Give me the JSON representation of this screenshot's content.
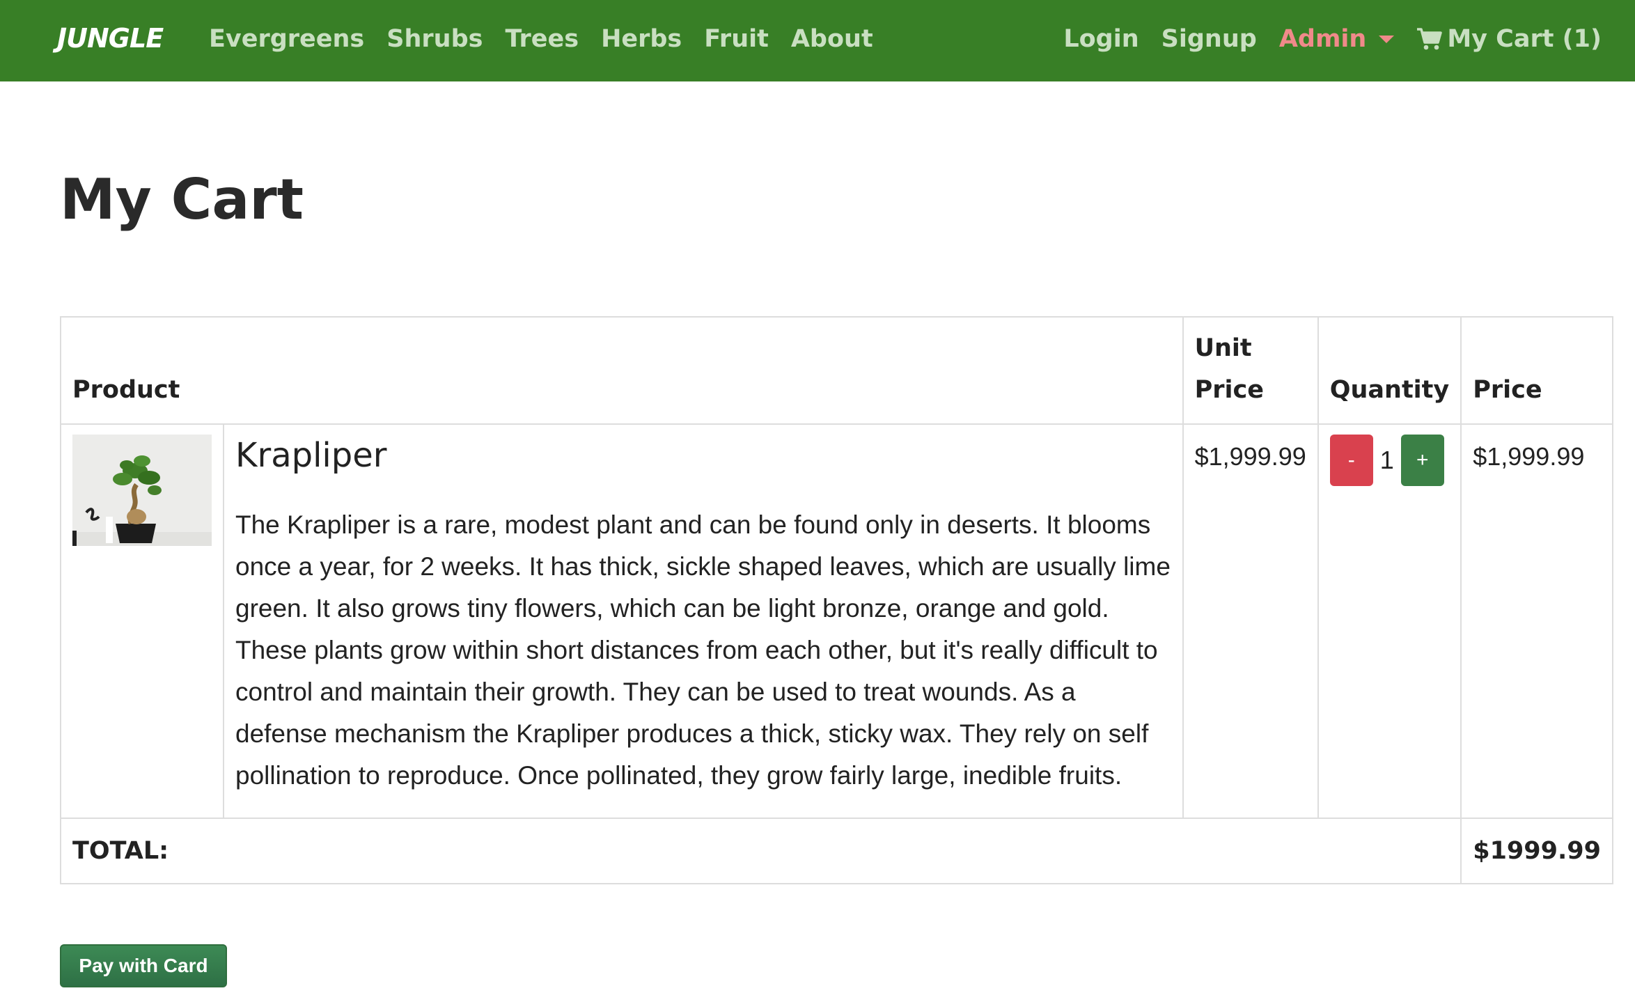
{
  "navbar": {
    "brand": "JUNGLE",
    "links": [
      "Evergreens",
      "Shrubs",
      "Trees",
      "Herbs",
      "Fruit",
      "About"
    ],
    "login": "Login",
    "signup": "Signup",
    "admin": "Admin",
    "cart": "My Cart (1)",
    "icons": {
      "cart": "shopping-cart-icon",
      "admin_caret": "caret-down-icon"
    },
    "colors": {
      "background": "#387f26",
      "admin": "#f08a8a",
      "links": "#c9dfc1"
    }
  },
  "page": {
    "title": "My Cart"
  },
  "table": {
    "headers": {
      "product": "Product",
      "unit_price": "Unit Price",
      "quantity": "Quantity",
      "price": "Price"
    },
    "items": [
      {
        "name": "Krapliper",
        "description": "The Krapliper is a rare, modest plant and can be found only in deserts. It blooms once a year, for 2 weeks. It has thick, sickle shaped leaves, which are usually lime green. It also grows tiny flowers, which can be light bronze, orange and gold. These plants grow within short distances from each other, but it's really difficult to control and maintain their growth. They can be used to treat wounds. As a defense mechanism the Krapliper produces a thick, sticky wax. They rely on self pollination to reproduce. Once pollinated, they grow fairly large, inedible fruits.",
        "unit_price": "$1,999.99",
        "quantity": "1",
        "decrement_label": "-",
        "increment_label": "+",
        "price": "$1,999.99"
      }
    ],
    "total_label": "TOTAL:",
    "total_value": "$1999.99"
  },
  "actions": {
    "pay_label": "Pay with Card"
  }
}
